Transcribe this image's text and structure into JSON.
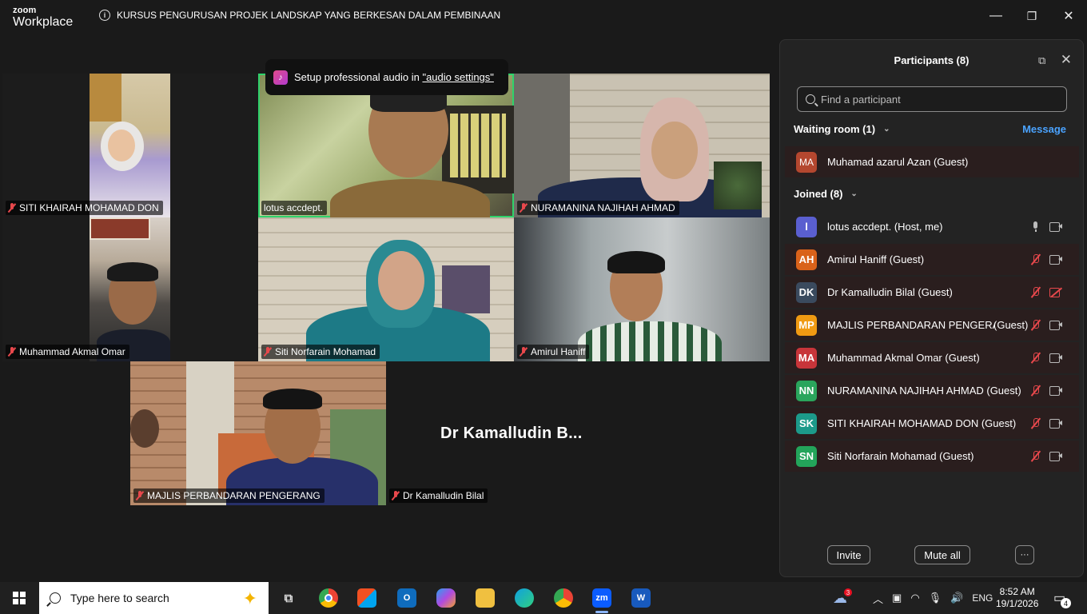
{
  "app": {
    "logo_top": "zoom",
    "logo_bottom": "Workplace",
    "meeting_title": "KURSUS PENGURUSAN PROJEK LANDSKAP YANG BERKESAN DALAM PEMBINAAN"
  },
  "window_controls": {
    "minimize": "—",
    "maximize": "❐",
    "close": "✕"
  },
  "toast": {
    "text": "Setup professional audio in ",
    "link": "\"audio settings\""
  },
  "tiles": [
    {
      "name": "SITI KHAIRAH MOHAMAD DON",
      "muted": true
    },
    {
      "name": "lotus accdept.",
      "muted": false,
      "active_speaker": true
    },
    {
      "name": "NURAMANINA NAJIHAH AHMAD",
      "muted": true
    },
    {
      "name": "Muhammad Akmal Omar",
      "muted": true
    },
    {
      "name": "Siti Norfarain Mohamad",
      "muted": true
    },
    {
      "name": "Amirul Haniff",
      "muted": true
    },
    {
      "name": "MAJLIS PERBANDARAN PENGERANG",
      "muted": true
    },
    {
      "name": "Dr Kamalludin Bilal",
      "muted": true,
      "video_off": true,
      "display_name": "Dr Kamalludin B..."
    }
  ],
  "panel": {
    "title": "Participants (8)",
    "search_placeholder": "Find a participant",
    "waiting_room_label": "Waiting room (1)",
    "message_label": "Message",
    "joined_label": "Joined (8)",
    "waiting": [
      {
        "initials": "MA",
        "name": "Muhamad azarul Azan (Guest)",
        "color": "#b4472f"
      }
    ],
    "joined": [
      {
        "initials": "l",
        "name": "lotus accdept. (Host, me)",
        "color": "#5a5fd0",
        "mic": "on",
        "cam": "on"
      },
      {
        "initials": "AH",
        "name": "Amirul Haniff (Guest)",
        "color": "#d9621a",
        "mic": "off",
        "cam": "on"
      },
      {
        "initials": "DK",
        "name": "Dr Kamalludin Bilal (Guest)",
        "color": "#3a4a5e",
        "mic": "off",
        "cam": "off"
      },
      {
        "initials": "MP",
        "name": "MAJLIS PERBANDARAN PENGERA...",
        "suffix": "(Guest)",
        "color": "#f09a12",
        "mic": "off",
        "cam": "on"
      },
      {
        "initials": "MA",
        "name": "Muhammad Akmal Omar (Guest)",
        "color": "#c8353a",
        "mic": "off",
        "cam": "on"
      },
      {
        "initials": "NN",
        "name": "NURAMANINA NAJIHAH AHMAD (Guest)",
        "color": "#2aa55c",
        "mic": "off",
        "cam": "on"
      },
      {
        "initials": "SK",
        "name": "SITI KHAIRAH MOHAMAD DON (Guest)",
        "color": "#1c9a8a",
        "mic": "off",
        "cam": "on"
      },
      {
        "initials": "SN",
        "name": "Siti Norfarain Mohamad (Guest)",
        "color": "#23a45a",
        "mic": "off",
        "cam": "on"
      }
    ],
    "invite_label": "Invite",
    "mute_all_label": "Mute all",
    "more_label": "···"
  },
  "taskbar": {
    "search_placeholder": "Type here to search",
    "weather_badge": "3",
    "language": "ENG",
    "time": "8:52 AM",
    "date": "19/1/2026",
    "notification_count": "4",
    "zoom_label": "zm",
    "word_label": "W"
  }
}
